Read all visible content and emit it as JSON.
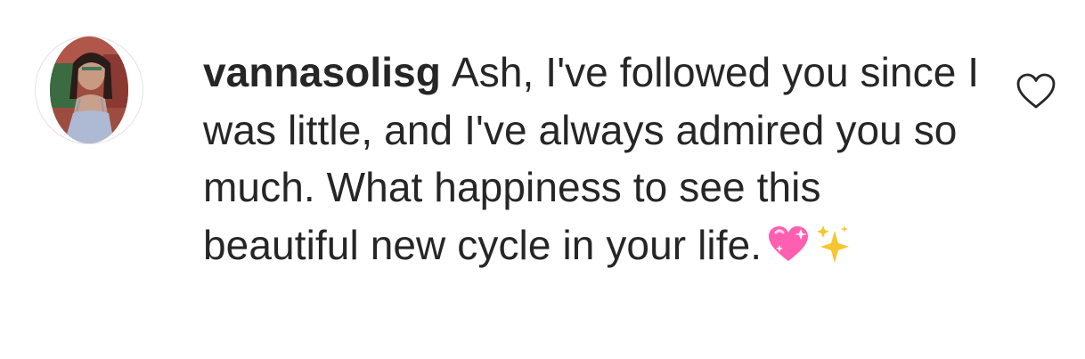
{
  "comment": {
    "username": "vannasolisg",
    "text": "Ash, I've followed you since I was little, and I've always admired you so much. What happiness to see this beautiful new cycle in your life.",
    "emojis": [
      "sparkling-heart",
      "sparkles"
    ]
  },
  "icons": {
    "like": "heart-outline-icon"
  },
  "colors": {
    "text": "#262626",
    "avatar_border": "#e3e3e3",
    "heart_stroke": "#262626",
    "emoji_heart": "#ff5fb0",
    "emoji_sparkles": "#f7c531"
  }
}
